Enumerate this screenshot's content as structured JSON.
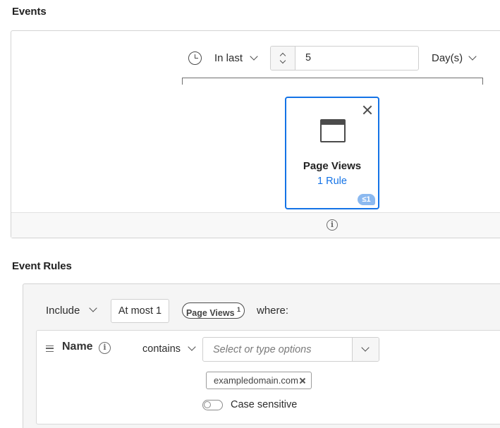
{
  "events": {
    "section_title": "Events",
    "time_range": {
      "operator_label": "In last",
      "value": "5",
      "unit_label": "Day(s)"
    },
    "event_card": {
      "title": "Page Views",
      "rule_count_label": "1 Rule",
      "badge": "≤1"
    },
    "footer_icon": "info-icon"
  },
  "event_rules": {
    "section_title": "Event Rules",
    "include_label": "Include",
    "frequency_label": "At most 1",
    "event_pill": {
      "label": "Page Views",
      "superscript": "1"
    },
    "where_label": "where:",
    "rule": {
      "field_label": "Name",
      "operator_label": "contains",
      "combo_placeholder": "Select or type options",
      "tags": [
        "exampledomain.com"
      ],
      "case_sensitive_label": "Case sensitive",
      "case_sensitive": false
    }
  },
  "colors": {
    "accent": "#1473e6",
    "badge": "#8bb9f0",
    "border": "#d3d3d3"
  }
}
